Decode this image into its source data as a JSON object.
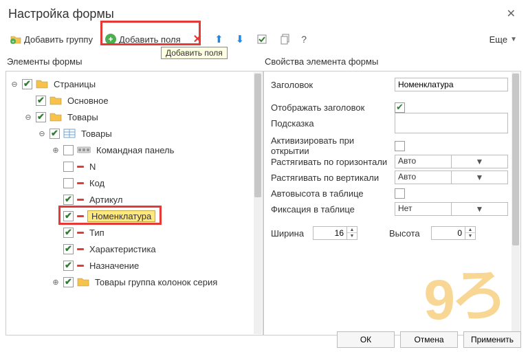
{
  "window": {
    "title": "Настройка формы"
  },
  "toolbar": {
    "add_group": "Добавить группу",
    "add_fields": "Добавить поля",
    "tooltip_add_fields": "Добавить поля",
    "more": "Еще"
  },
  "left": {
    "title": "Элементы формы",
    "items": [
      {
        "lvl": 0,
        "exp": "−",
        "chk": true,
        "icon": "folder",
        "label": "Страницы"
      },
      {
        "lvl": 1,
        "exp": "",
        "chk": true,
        "icon": "folder",
        "label": "Основное"
      },
      {
        "lvl": 1,
        "exp": "−",
        "chk": true,
        "icon": "folder",
        "label": "Товары"
      },
      {
        "lvl": 2,
        "exp": "−",
        "chk": true,
        "icon": "table",
        "label": "Товары"
      },
      {
        "lvl": 3,
        "exp": "+",
        "chk": false,
        "icon": "cmd",
        "label": "Командная панель"
      },
      {
        "lvl": 3,
        "exp": "",
        "chk": false,
        "icon": "dash",
        "label": "N"
      },
      {
        "lvl": 3,
        "exp": "",
        "chk": false,
        "icon": "dash",
        "label": "Код"
      },
      {
        "lvl": 3,
        "exp": "",
        "chk": true,
        "icon": "dash",
        "label": "Артикул"
      },
      {
        "lvl": 3,
        "exp": "",
        "chk": true,
        "icon": "dash",
        "label": "Номенклатура",
        "selected": true
      },
      {
        "lvl": 3,
        "exp": "",
        "chk": true,
        "icon": "dash",
        "label": "Тип"
      },
      {
        "lvl": 3,
        "exp": "",
        "chk": true,
        "icon": "dash",
        "label": "Характеристика"
      },
      {
        "lvl": 3,
        "exp": "",
        "chk": true,
        "icon": "dash",
        "label": "Назначение"
      },
      {
        "lvl": 3,
        "exp": "+",
        "chk": true,
        "icon": "folder",
        "label": "Товары группа колонок серия"
      }
    ]
  },
  "right": {
    "title": "Свойства элемента формы",
    "rows": {
      "header_lbl": "Заголовок",
      "header_val": "Номенклатура",
      "show_header_lbl": "Отображать заголовок",
      "show_header_val": true,
      "hint_lbl": "Подсказка",
      "hint_val": "",
      "activate_lbl": "Активизировать при открытии",
      "activate_val": false,
      "stretch_h_lbl": "Растягивать по горизонтали",
      "stretch_h_val": "Авто",
      "stretch_v_lbl": "Растягивать по вертикали",
      "stretch_v_val": "Авто",
      "autoheight_lbl": "Автовысота в таблице",
      "autoheight_val": false,
      "fix_lbl": "Фиксация в таблице",
      "fix_val": "Нет",
      "width_lbl": "Ширина",
      "width_val": "16",
      "height_lbl": "Высота",
      "height_val": "0"
    }
  },
  "buttons": {
    "ok": "ОК",
    "cancel": "Отмена",
    "apply": "Применить"
  }
}
